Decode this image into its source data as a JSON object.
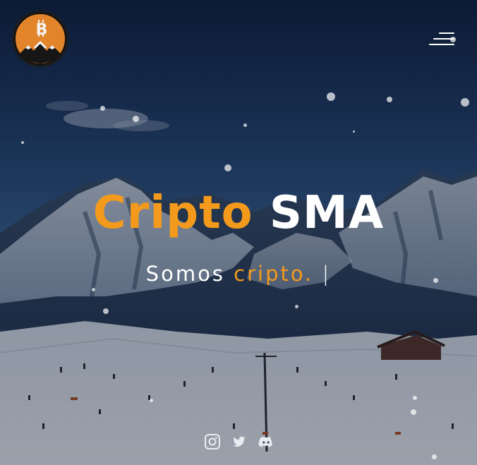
{
  "hero": {
    "title_part1": "Cripto",
    "title_part2": "SMA",
    "subtitle_part1": "Somos",
    "subtitle_part2": "cripto.",
    "cursor": "|"
  },
  "header": {
    "logo_icon": "bitcoin-mountain-logo",
    "menu_icon": "hamburger-menu-icon"
  },
  "socials": [
    {
      "icon": "instagram-icon"
    },
    {
      "icon": "twitter-icon"
    },
    {
      "icon": "discord-icon"
    }
  ],
  "colors": {
    "accent": "#f39a1c",
    "text": "#ffffff",
    "logo_bg": "#1c1c1c"
  }
}
